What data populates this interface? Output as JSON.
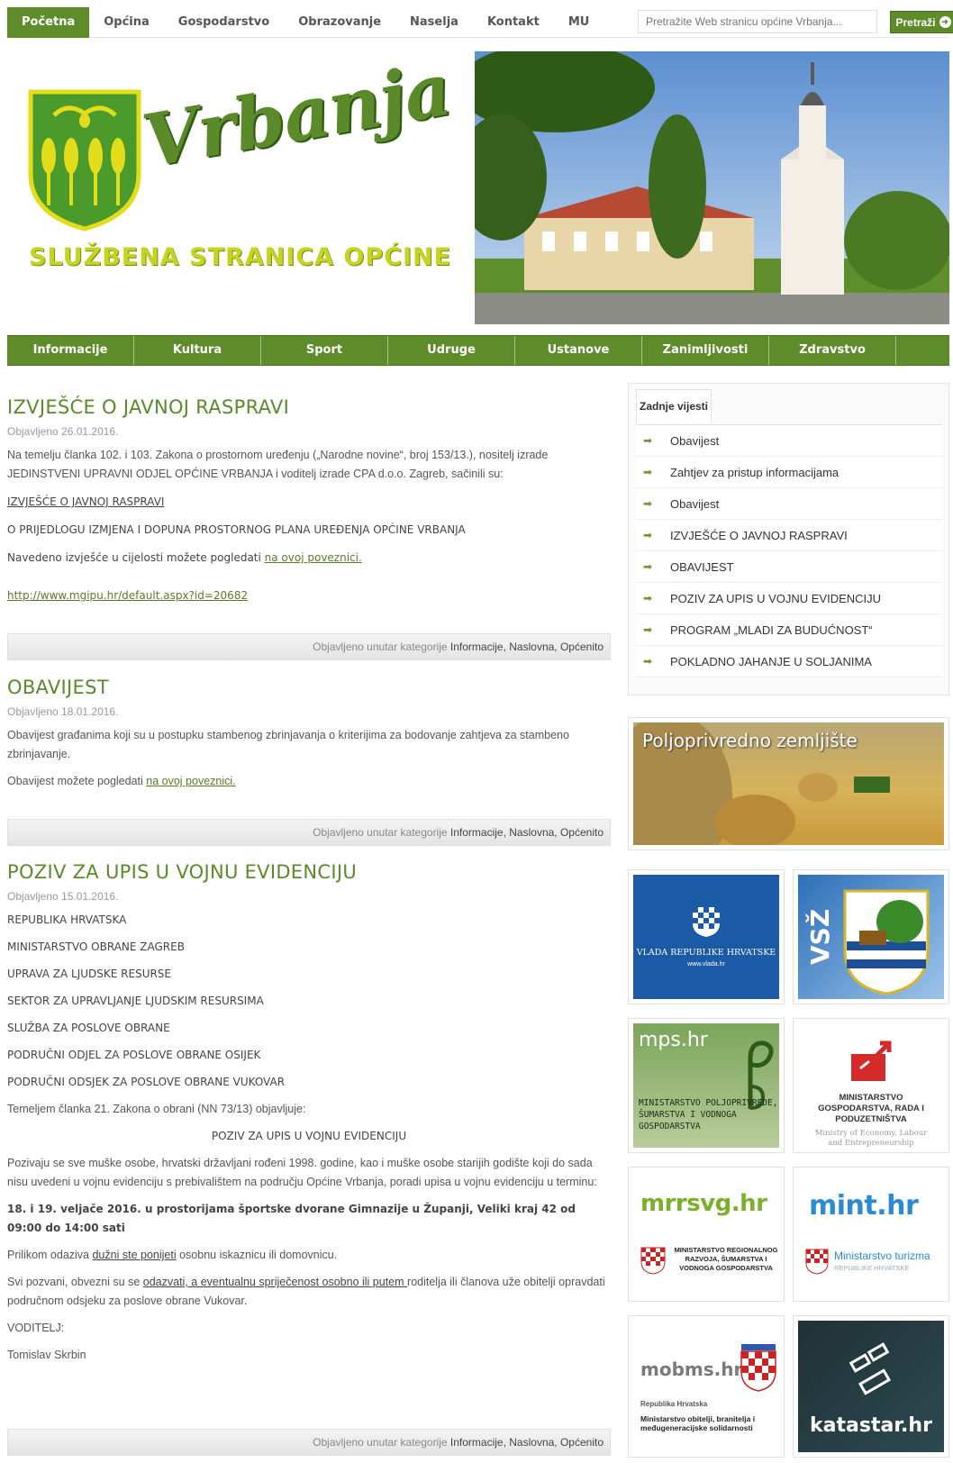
{
  "topnav": {
    "items": [
      "Početna",
      "Općina",
      "Gospodarstvo",
      "Obrazovanje",
      "Naselja",
      "Kontakt",
      "MU"
    ],
    "search_placeholder": "Pretražite Web stranicu općine Vrbanja...",
    "search_button": "Pretraži"
  },
  "header": {
    "logo_title": "Vrbanja",
    "logo_subtitle": "SLUŽBENA STRANICA OPĆINE"
  },
  "mainnav": {
    "items": [
      "Informacije",
      "Kultura",
      "Sport",
      "Udruge",
      "Ustanove",
      "Zanimljivosti",
      "Zdravstvo"
    ]
  },
  "articles": [
    {
      "title": "IZVJEŠĆE O JAVNOJ RASPRAVI",
      "date": "Objavljeno 26.01.2016.",
      "intro": "Na temelju članka 102. i 103. Zakona o prostornom uređenju („Narodne novine“, broj 153/13.), nositelj izrade JEDINSTVENI UPRAVNI ODJEL OPĆINE VRBANJA i voditelj izrade CPA d.o.o. Zagreb, sačinili su:",
      "heading_link": "IZVJEŠĆE O JAVNOJ RASPRAVI",
      "subheading": "O PRIJEDLOGU  IZMJENA I DOPUNA  PROSTORNOG PLANA UREĐENJA OPĆINE VRBANJA",
      "view_text": "Navedeno izvješće u cijelosti možete pogledati ",
      "view_link": "na ovoj poveznici.",
      "url": "http://www.mgipu.hr/default.aspx?id=20682"
    },
    {
      "title": "OBAVIJEST",
      "date": "Objavljeno 18.01.2016.",
      "intro": "Obavijest građanima koji su u postupku stambenog zbrinjavanja o kriterijima za bodovanje zahtjeva za stambeno zbrinjavanje.",
      "view_text": "Obavijest možete pogledati ",
      "view_link": "na ovoj poveznici."
    },
    {
      "title": "POZIV ZA UPIS U VOJNU EVIDENCIJU",
      "date": "Objavljeno 15.01.2016.",
      "lines": [
        "REPUBLIKA HRVATSKA",
        "MINISTARSTVO OBRANE ZAGREB",
        "UPRAVA ZA LJUDSKE RESURSE",
        "SEKTOR ZA UPRAVLJANJE LJUDSKIM RESURSIMA",
        "SLUŽBA ZA POSLOVE OBRANE",
        "PODRUČNI ODJEL ZA POSLOVE OBRANE OSIJEK",
        "PODRUČNI ODSJEK ZA POSLOVE OBRANE VUKOVAR"
      ],
      "law": "Temeljem članka 21. Zakona o obrani (NN 73/13) objavljuje:",
      "center_title": "POZIV ZA UPIS U VOJNU EVIDENCIJU",
      "body": "Pozivaju se sve muške osobe, hrvatski državljani rođeni 1998. godine, kao i muške osobe starijih godište koji do sada nisu uvedeni u vojnu evidenciju s prebivalištem na području Općine Vrbanja, poradi upisa u vojnu evidenciju u terminu:",
      "date_place": "18. i 19. veljače 2016. u prostorijama športske dvorane Gimnazije u Županji, Veliki kraj 42 od 09:00 do 14:00 sati",
      "id_pre": "Prilikom odaziva ",
      "id_link": "dužni ste ponijeti",
      "id_post": " osobnu iskaznicu ili domovnicu.",
      "oblig_pre": "Svi pozvani, obvezni su se ",
      "oblig_link": "odazvati, a eventualnu spriječenost osobno ili putem ",
      "oblig_post": "roditelja ili članova uže obitelji opravdati područnom odsjeku za poslove obrane Vukovar.",
      "leader_label": "VODITELJ:",
      "leader_name": "Tomislav Skrbin"
    }
  ],
  "footer": {
    "prefix": "Objavljeno unutar kategorije ",
    "categories": "Informacije, Naslovna, Općenito"
  },
  "sidebar": {
    "tab": "Zadnje vijesti",
    "news": [
      "Obavijest",
      "Zahtjev za pristup informacijama",
      "Obavijest",
      "IZVJEŠĆE O JAVNOJ RASPRAVI",
      "OBAVIJEST",
      "POZIV ZA UPIS U VOJNU EVIDENCIJU",
      "PROGRAM „MLADI ZA BUDUĆNOST“",
      "POKLADNO JAHANJE U SOLJANIMA"
    ],
    "banners": {
      "poljo": "Poljoprivredno zemljište",
      "vlada": "VLADA REPUBLIKE HRVATSKE",
      "vlada_url": "www.vlada.hr",
      "vsz": "VSŽ",
      "mps": "mps.hr",
      "mps_sub": "MINISTARSTVO POLJOPRIVREDE, ŠUMARSTVA I VODNOGA GOSPODARSTVA",
      "mingo": "MINISTARSTVO GOSPODARSTVA, RADA I PODUZETNIŠTVA",
      "mingo_en": "Ministry of Economy, Labour and Entrepreneurship",
      "mrrsvg": "mrrsvg.hr",
      "mrrsvg_sub": "MINISTARSTVO REGIONALNOG RAZVOJA, ŠUMARSTVA I VODNOGA GOSPODARSTVA",
      "mint": "mint.hr",
      "mint_sub": "Ministarstvo turizma",
      "mint_sub2": "REPUBLIKE HRVATSKE",
      "mobms": "mobms.hr",
      "mobms_rh": "Republika Hrvatska",
      "mobms_sub": "Ministarstvo obitelji, branitelja i međugeneracijske solidarnosti",
      "katastar": "katastar.hr"
    }
  }
}
